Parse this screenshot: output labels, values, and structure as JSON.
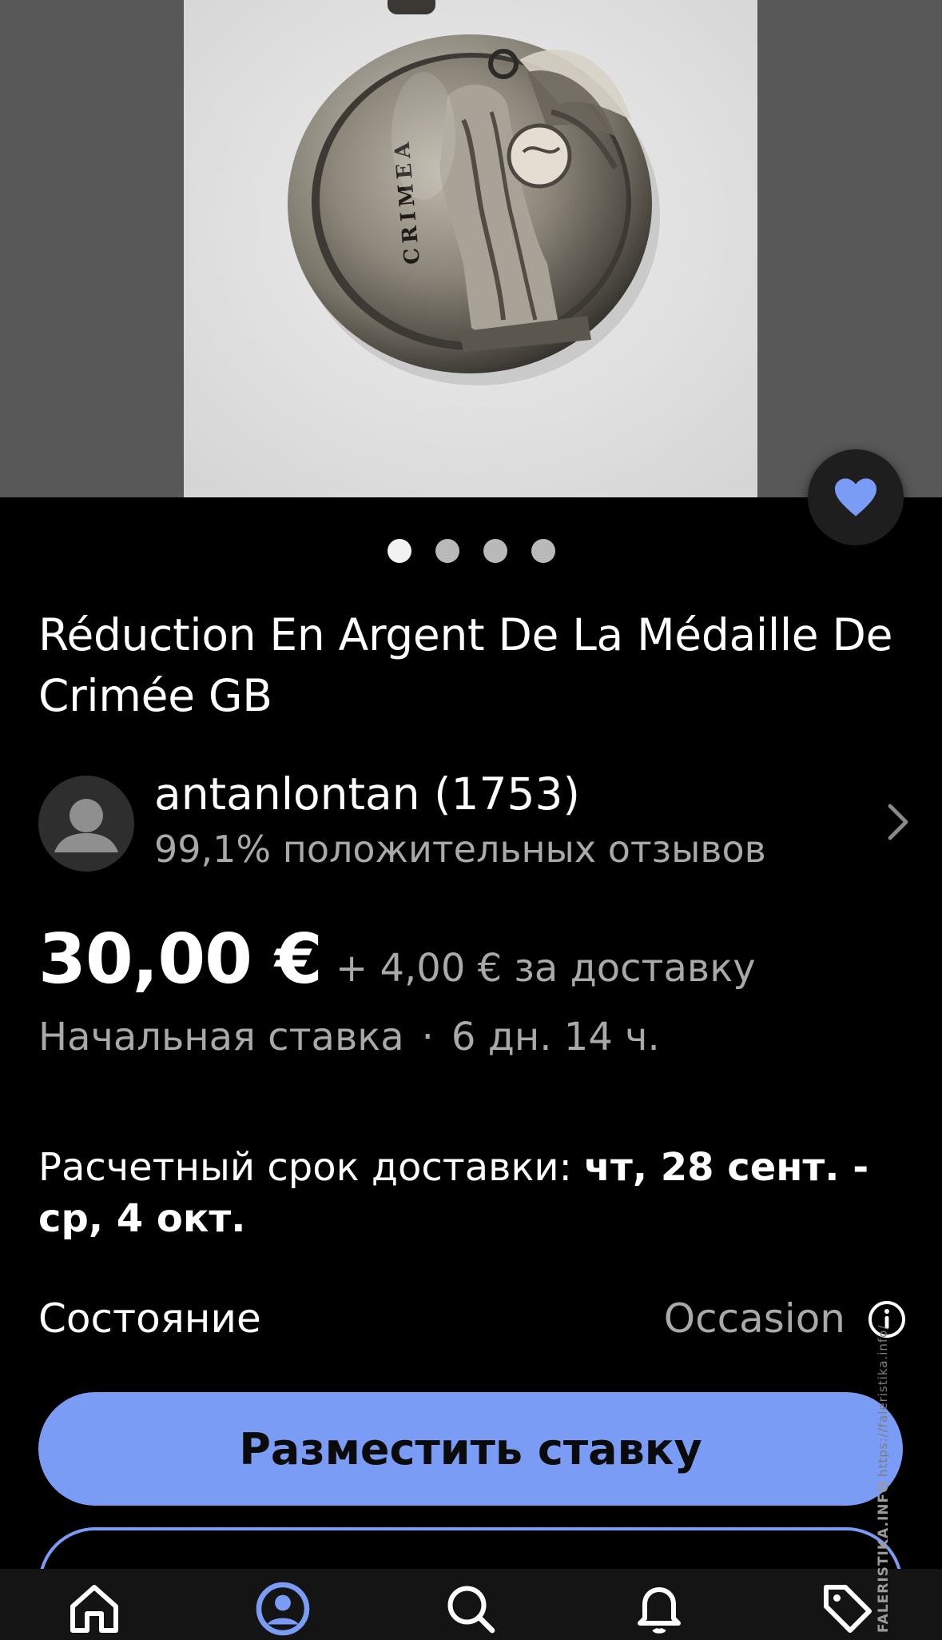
{
  "product": {
    "title": "Réduction En Argent De La Médaille De Crimée GB",
    "image_alt": "Silver medal reduction with figure of Victory",
    "image_inscription": "CRIMEA",
    "gallery": {
      "total_images": 4,
      "active_index": 0
    },
    "favorited": true
  },
  "seller": {
    "name": "antanlontan (1753)",
    "feedback": "99,1% положительных отзывов"
  },
  "price": {
    "amount": "30,00 €",
    "shipping": "+ 4,00 € за доставку"
  },
  "auction": {
    "bid_type": "Начальная ставка",
    "separator": "·",
    "time_left": "6 дн. 14 ч."
  },
  "delivery": {
    "label": "Расчетный срок доставки:",
    "dates": "чт, 28 сент. - ср, 4 окт."
  },
  "condition": {
    "label": "Состояние",
    "value": "Occasion"
  },
  "actions": {
    "place_bid_label": "Разместить ставку"
  },
  "watermark": {
    "brand": "FALERISTIKA.INFO",
    "url": "https://faleristika.info/"
  },
  "colors": {
    "accent": "#7a9cf4",
    "favorite_heart": "#7a9cf4",
    "background": "#000000",
    "secondary_text": "#a9a9a9"
  },
  "tabbar": {
    "items": [
      "home-icon",
      "profile-icon",
      "search-icon",
      "notifications-icon",
      "selling-tag-icon"
    ],
    "active": "profile-icon"
  }
}
